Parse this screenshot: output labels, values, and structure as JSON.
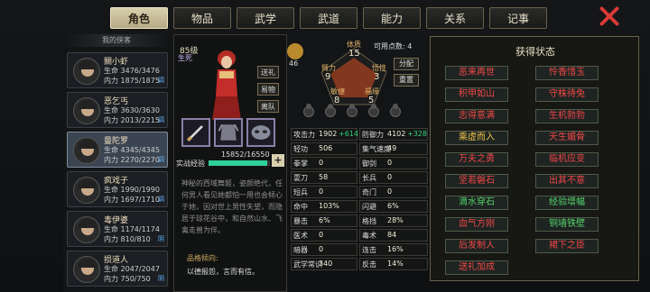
{
  "tabs": [
    "角色",
    "物品",
    "武学",
    "武道",
    "能力",
    "关系",
    "记事"
  ],
  "list": {
    "title": "我的侠客",
    "heroes": [
      {
        "name": "關小虾",
        "life": "生命 3476/3476",
        "inner": "内力 1875/1875",
        "tag": "调"
      },
      {
        "name": "恶乞丐",
        "life": "生命 3630/3630",
        "inner": "内力 2013/2215",
        "tag": "调"
      },
      {
        "name": "曼陀罗",
        "life": "生命 4345/4345",
        "inner": "内力 2270/2270",
        "tag": "调"
      },
      {
        "name": "疯戏子",
        "life": "生命 1990/1990",
        "inner": "内力 1697/1710",
        "tag": "调"
      },
      {
        "name": "毒伊婆",
        "life": "生命 1174/1174",
        "inner": "内力 810/810",
        "tag": "阴"
      },
      {
        "name": "损道人",
        "life": "生命 2047/2047",
        "inner": "内力 750/750",
        "tag": "阴"
      }
    ]
  },
  "center": {
    "level": "85级",
    "status": "生死",
    "send": "送礼",
    "dress": "易物",
    "leave": "离队",
    "exp_label": "实战经验",
    "exp_text": "15852/16550",
    "exp_ratio": 0.958,
    "desc": "神秘的西域舞姬，姿颜绝代，任何男人看见她都怕一用也会倾心于她，因对世上男性失望，而隐居于琼花谷中，和自然山水、飞禽走兽为伴。",
    "personality_title": "品格倾向:",
    "personality": "以德报怨，言而有信。"
  },
  "attrs": {
    "coin": "46",
    "tizhi_label": "体质",
    "tizhi": "15",
    "bili_label": "臂力",
    "bili": "9",
    "wuxing_label": "悟性",
    "wuxing": "3",
    "minjie_label": "敏捷",
    "minjie": "8",
    "fuyuan_label": "福缘",
    "fuyuan": "5",
    "points_label": "可用点数:",
    "points": "4",
    "assign": "分配",
    "reset": "重置"
  },
  "stats": [
    {
      "n": "攻击力",
      "v": "1902",
      "g": "+614"
    },
    {
      "n": "防御力",
      "v": "4102",
      "g": "+328"
    },
    {
      "n": "轻功",
      "v": "506",
      "g": ""
    },
    {
      "n": "集气速度",
      "v": "49",
      "g": ""
    },
    {
      "n": "拳掌",
      "v": "0",
      "g": ""
    },
    {
      "n": "御剑",
      "v": "0",
      "g": ""
    },
    {
      "n": "耍刀",
      "v": "58",
      "g": ""
    },
    {
      "n": "长兵",
      "v": "0",
      "g": ""
    },
    {
      "n": "短兵",
      "v": "0",
      "g": ""
    },
    {
      "n": "奇门",
      "v": "0",
      "g": ""
    },
    {
      "n": "命中",
      "v": "103%",
      "g": ""
    },
    {
      "n": "闪避",
      "v": "6%",
      "g": ""
    },
    {
      "n": "暴击",
      "v": "6%",
      "g": ""
    },
    {
      "n": "格挡",
      "v": "28%",
      "g": ""
    },
    {
      "n": "医术",
      "v": "0",
      "g": ""
    },
    {
      "n": "毒术",
      "v": "84",
      "g": ""
    },
    {
      "n": "暗器",
      "v": "0",
      "g": ""
    },
    {
      "n": "连击",
      "v": "16%",
      "g": ""
    },
    {
      "n": "武学常识",
      "v": "340",
      "g": ""
    },
    {
      "n": "反击",
      "v": "14%",
      "g": ""
    }
  ],
  "states": {
    "title": "获得状态",
    "items": [
      {
        "t": "恶来再世",
        "c": "r"
      },
      {
        "t": "怜香惜玉",
        "c": "r"
      },
      {
        "t": "积甲如山",
        "c": "r"
      },
      {
        "t": "守株待兔",
        "c": "r"
      },
      {
        "t": "志得意满",
        "c": "r"
      },
      {
        "t": "生机勃勃",
        "c": "r"
      },
      {
        "t": "乘虚而入",
        "c": "y"
      },
      {
        "t": "天生媚骨",
        "c": "r"
      },
      {
        "t": "万夫之勇",
        "c": "r"
      },
      {
        "t": "临机应变",
        "c": "r"
      },
      {
        "t": "坚若磐石",
        "c": "r"
      },
      {
        "t": "出其不意",
        "c": "r"
      },
      {
        "t": "滴水穿石",
        "c": "g"
      },
      {
        "t": "经验增幅",
        "c": "g"
      },
      {
        "t": "血气方刚",
        "c": "r"
      },
      {
        "t": "铜墙铁壁",
        "c": "g"
      },
      {
        "t": "后发制人",
        "c": "r"
      },
      {
        "t": "裙下之臣",
        "c": "r"
      },
      {
        "t": "送礼加成",
        "c": "r"
      }
    ]
  }
}
